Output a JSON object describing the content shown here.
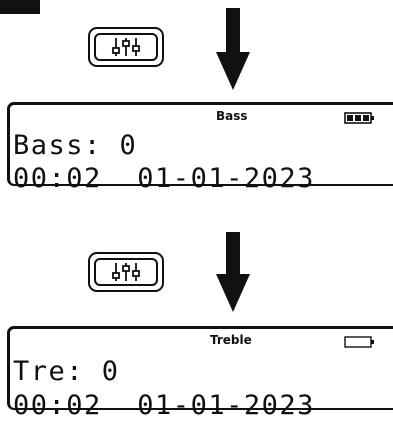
{
  "panels": [
    {
      "mode_label": "Bass",
      "setting_line": "Bass: 0",
      "time": "00:02",
      "date": "01-01-2023",
      "battery": "full"
    },
    {
      "mode_label": "Treble",
      "setting_line": "Tre: 0",
      "time": "00:02",
      "date": "01-01-2023",
      "battery": "empty"
    }
  ],
  "icons": {
    "button": "equalizer-sliders-icon",
    "arrow": "arrow-down-icon",
    "battery_full": "battery-full-icon",
    "battery_empty": "battery-empty-icon"
  }
}
